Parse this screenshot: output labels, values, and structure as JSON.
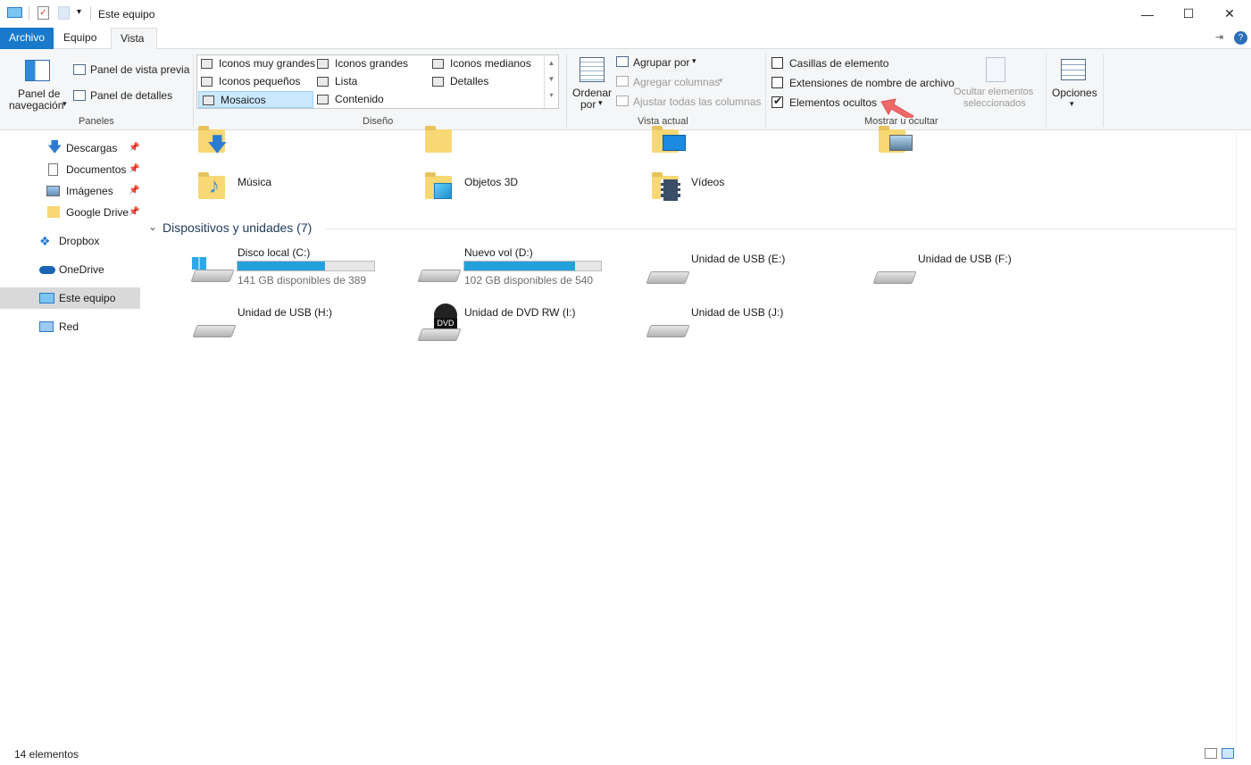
{
  "window": {
    "title": "Este equipo",
    "minimize": "—",
    "maximize": "☐",
    "close": "✕"
  },
  "tabs": {
    "file": "Archivo",
    "items": [
      "Equipo",
      "Vista"
    ],
    "active": "Vista"
  },
  "ribbon": {
    "panes": {
      "nav_pane_line1": "Panel de",
      "nav_pane_line2": "navegación",
      "preview_pane": "Panel de vista previa",
      "details_pane": "Panel de detalles",
      "group_label": "Paneles"
    },
    "layout": {
      "items": [
        [
          "Iconos muy grandes",
          "Iconos grandes",
          "Iconos medianos"
        ],
        [
          "Iconos pequeños",
          "Lista",
          "Detalles"
        ],
        [
          "Mosaicos",
          "Contenido",
          ""
        ]
      ],
      "selected": "Mosaicos",
      "group_label": "Diseño"
    },
    "current_view": {
      "sort_line1": "Ordenar",
      "sort_line2": "por",
      "group_by": "Agrupar por",
      "add_columns": "Agregar columnas",
      "fit_columns": "Ajustar todas las columnas",
      "group_label": "Vista actual"
    },
    "show_hide": {
      "item_checkboxes": "Casillas de elemento",
      "file_extensions": "Extensiones de nombre de archivo",
      "hidden_items": "Elementos ocultos",
      "hidden_items_checked": true,
      "item_checkboxes_checked": false,
      "file_extensions_checked": false,
      "hide_selected_line1": "Ocultar elementos",
      "hide_selected_line2": "seleccionados",
      "group_label": "Mostrar u ocultar"
    },
    "options": "Opciones"
  },
  "nav": {
    "items": [
      {
        "label": "Descargas",
        "pinned": true
      },
      {
        "label": "Documentos",
        "pinned": true
      },
      {
        "label": "Imágenes",
        "pinned": true
      },
      {
        "label": "Google Drive",
        "pinned": true
      },
      {
        "label": "Dropbox",
        "pinned": false
      },
      {
        "label": "OneDrive",
        "pinned": false
      },
      {
        "label": "Este equipo",
        "pinned": false,
        "selected": true
      },
      {
        "label": "Red",
        "pinned": false
      }
    ]
  },
  "folders": {
    "items": [
      "Música",
      "Objetos 3D",
      "Vídeos"
    ]
  },
  "devices": {
    "header": "Dispositivos y unidades (7)",
    "drives": [
      {
        "name": "Disco local (C:)",
        "free": "141 GB disponibles de 389",
        "used_fraction": 0.64
      },
      {
        "name": "Nuevo vol (D:)",
        "free": "102 GB disponibles de 540",
        "used_fraction": 0.81
      },
      {
        "name": "Unidad de USB (E:)"
      },
      {
        "name": "Unidad de USB (F:)"
      },
      {
        "name": "Unidad de USB (H:)"
      },
      {
        "name": "Unidad de DVD RW (I:)",
        "badge": "DVD"
      },
      {
        "name": "Unidad de USB (J:)"
      }
    ]
  },
  "status": {
    "count": "14 elementos"
  },
  "colors": {
    "accent": "#1979ca",
    "bar_fill": "#26a0da",
    "folder": "#f8d775",
    "annotation_arrow": "#f06a6a"
  }
}
